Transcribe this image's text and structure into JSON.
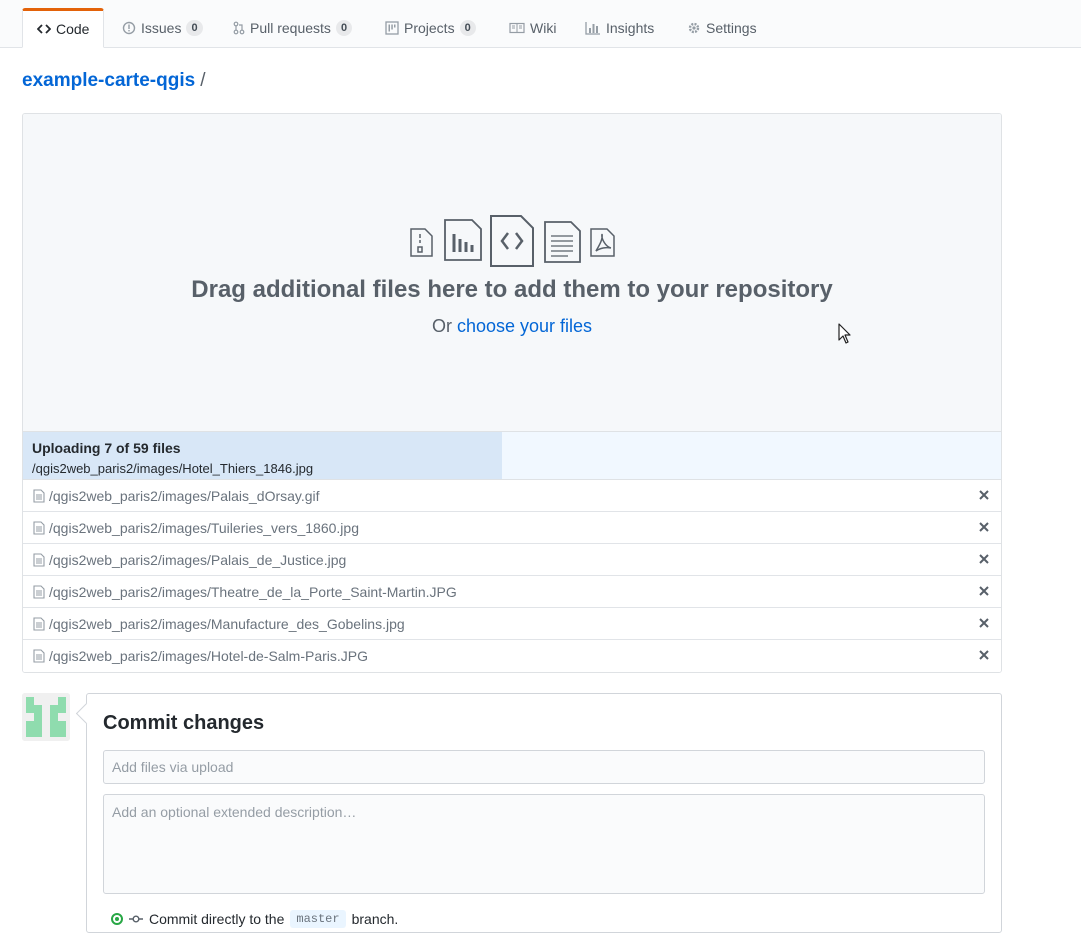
{
  "tabs": [
    {
      "label": "Code",
      "icon": "code-icon",
      "selected": true
    },
    {
      "label": "Issues",
      "icon": "issue-icon",
      "count": "0"
    },
    {
      "label": "Pull requests",
      "icon": "pull-request-icon",
      "count": "0"
    },
    {
      "label": "Projects",
      "icon": "project-icon",
      "count": "0"
    },
    {
      "label": "Wiki",
      "icon": "book-icon"
    },
    {
      "label": "Insights",
      "icon": "graph-icon"
    },
    {
      "label": "Settings",
      "icon": "gear-icon"
    }
  ],
  "breadcrumb": {
    "repo": "example-carte-qgis",
    "separator": "/"
  },
  "dropzone": {
    "title": "Drag additional files here to add them to your repository",
    "or_text": "Or",
    "choose_link": "choose your files"
  },
  "upload": {
    "status": "Uploading 7 of 59 files",
    "current_file": "/qgis2web_paris2/images/Hotel_Thiers_1846.jpg",
    "progress_fraction": 0.49
  },
  "files": [
    "/qgis2web_paris2/images/Palais_dOrsay.gif",
    "/qgis2web_paris2/images/Tuileries_vers_1860.jpg",
    "/qgis2web_paris2/images/Palais_de_Justice.jpg",
    "/qgis2web_paris2/images/Theatre_de_la_Porte_Saint-Martin.JPG",
    "/qgis2web_paris2/images/Manufacture_des_Gobelins.jpg",
    "/qgis2web_paris2/images/Hotel-de-Salm-Paris.JPG"
  ],
  "commit": {
    "title": "Commit changes",
    "summary_placeholder": "Add files via upload",
    "description_placeholder": "Add an optional extended description…",
    "option_prefix": "Commit directly to the",
    "branch": "master",
    "option_suffix": "branch."
  },
  "colors": {
    "accent_tab": "#e36209",
    "link": "#0366d6",
    "radio": "#28a745",
    "avatar": "#8fdcae"
  }
}
